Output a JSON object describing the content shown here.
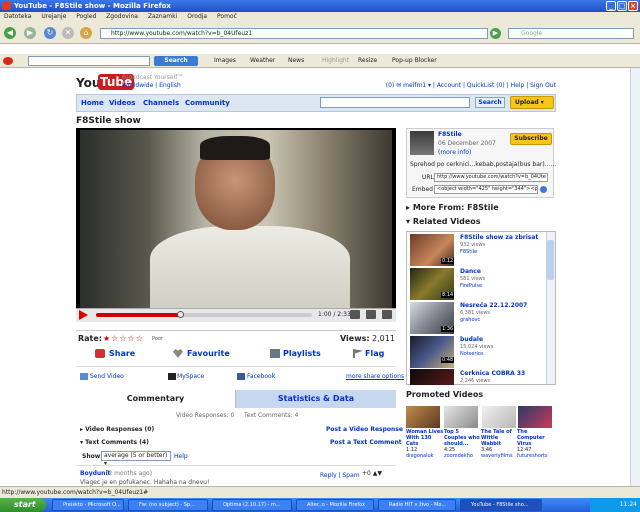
{
  "window": {
    "title": "YouTube - F8Stile show - Mozilla Firefox"
  },
  "menu": [
    "Datoteka",
    "Urejanje",
    "Pogled",
    "Zgodovina",
    "Zaznamki",
    "Orodja",
    "Pomoč"
  ],
  "browser": {
    "url": "http://www.youtube.com/watch?v=b_04Ufeuz1",
    "search_placeholder": "Google"
  },
  "yt_toolbar": {
    "search_label": "Search",
    "items": [
      "Images",
      "Weather",
      "News",
      "Highlight",
      "Resize",
      "Pop-up Blocker"
    ]
  },
  "header": {
    "logo_you": "You",
    "logo_tube": "Tube",
    "tagline": "Broadcast Yourself™",
    "locale": "Worldwide | English",
    "links": "(0) ✉ melfm1 ▾ | Account | QuickList (0) | Help | Sign Out"
  },
  "nav": {
    "tabs": [
      "Home",
      "Videos",
      "Channels",
      "Community"
    ],
    "search_button": "Search",
    "upload": "Upload"
  },
  "video": {
    "title": "F8Stile show",
    "time": "1:00 / 2:33",
    "progress": 0.39
  },
  "rating": {
    "label": "Rate:",
    "stars": "★☆☆☆☆",
    "text": "Poor",
    "views_label": "Views:",
    "views": "2,011"
  },
  "actions": [
    "Share",
    "Favourite",
    "Playlists",
    "Flag"
  ],
  "share": {
    "send": "Send Video",
    "myspace": "MySpace",
    "facebook": "Facebook",
    "more": "more share options"
  },
  "tabs2": {
    "comments": "Commentary",
    "stats": "Statistics & Data"
  },
  "responses": {
    "video_responses": "Video Responses: 0",
    "text_comments": "Text Comments: 4",
    "vr_section": "Video Responses (0)",
    "post_video": "Post a Video Response",
    "tc_section": "Text Comments (4)",
    "post_text": "Post a Text Comment",
    "show_label": "Show:",
    "show_value": "average (5 or better) ▾",
    "help": "Help"
  },
  "comment": {
    "user": "Boydunit",
    "when": "(2 months ago)",
    "reply": "Reply | Spam",
    "vote": "+0 ▲▼",
    "text": "Vlagec je en pofukanec. Hahaha na dnevu!"
  },
  "channel": {
    "name": "F8Stile",
    "date": "06 December 2007",
    "more": "(more info)",
    "subscribe": "Subscribe",
    "desc": "Sprehod po cerknici...kebab,postaja(bus bar)......",
    "url_label": "URL",
    "url_value": "http://www.youtube.com/watch?v=b_04Ute",
    "embed_label": "Embed",
    "embed_value": "<object width=\"425\" height=\"344\"><param"
  },
  "more_from": "More From: F8Stile",
  "related_head": "Related Videos",
  "related": [
    {
      "title": "F8Stile show za zbrisat",
      "views": "932 views",
      "author": "F8Stile",
      "dur": "0:12"
    },
    {
      "title": "Dance",
      "views": "581 views",
      "author": "FirePulse",
      "dur": "8:14"
    },
    {
      "title": "Nesreča 22.12.2007",
      "views": "6,381 views",
      "author": "grahovc",
      "dur": "1:36"
    },
    {
      "title": "budale",
      "views": "15,024 views",
      "author": "Notserios",
      "dur": "0:48"
    },
    {
      "title": "Cerknica COBRA 33",
      "views": "2,246 views",
      "author": "",
      "dur": ""
    }
  ],
  "promoted_head": "Promoted Videos",
  "promoted": [
    {
      "title": "Woman Lives With 130 Cats",
      "meta": "1:12",
      "author": "diegonaluk"
    },
    {
      "title": "Top 5 Couples who should...",
      "meta": "4:25",
      "author": "zoomdekho"
    },
    {
      "title": "The Tale of Wittle Wabbit",
      "meta": "3:46",
      "author": "waverlyfilms"
    },
    {
      "title": "The Computer Virus",
      "meta": "12:47",
      "author": "futureshorts"
    }
  ],
  "status": "http://www.youtube.com/watch?v=b_04Ufeuz1#",
  "taskbar": {
    "start": "start",
    "tasks": [
      "Preiskto - Microsoft O...",
      "Fw: (no subject) - Sp...",
      "Optima (2.10.17) - m...",
      "Alter..o - Mozilla Firefox",
      "Radio HIT v živo - Mo...",
      "YouTube - F8Stile sho..."
    ],
    "clock": "11:24"
  },
  "colors": {
    "link": "#0033cc",
    "accent": "#cc0000",
    "upload": "#f5c51a"
  }
}
